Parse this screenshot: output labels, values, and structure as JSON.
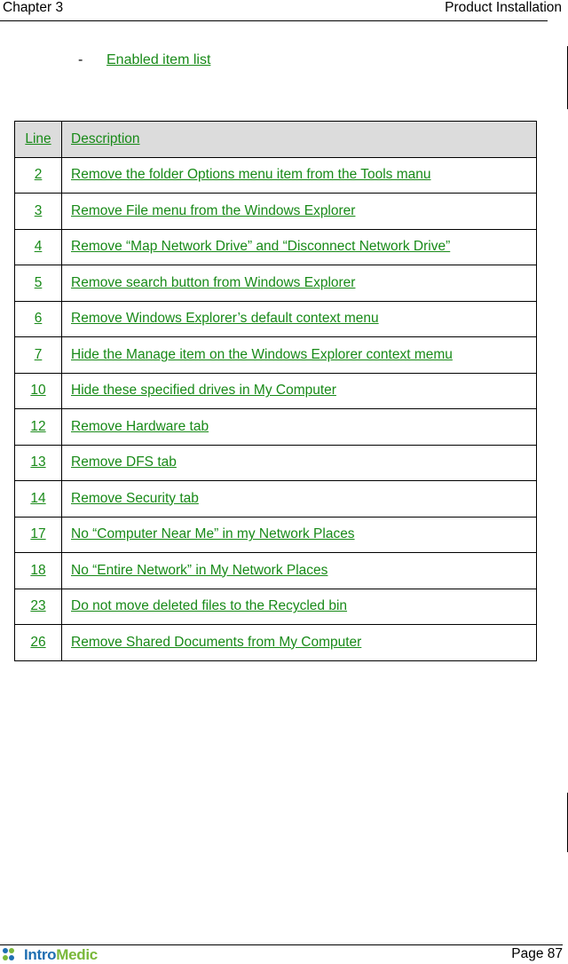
{
  "header": {
    "chapter": "Chapter 3",
    "section": "Product Installation"
  },
  "bullet": {
    "marker": "-",
    "label": "Enabled item list"
  },
  "table": {
    "columns": [
      "Line",
      "Description"
    ],
    "rows": [
      {
        "line": "2",
        "description": "Remove the folder Options menu item from the Tools manu"
      },
      {
        "line": "3",
        "description": "Remove File menu from the Windows Explorer"
      },
      {
        "line": "4",
        "description": "Remove “Map Network Drive” and “Disconnect Network Drive”"
      },
      {
        "line": "5",
        "description": "Remove search button from Windows Explorer"
      },
      {
        "line": "6",
        "description": "Remove Windows Explorer’s default context menu"
      },
      {
        "line": "7",
        "description": "Hide the Manage item on the Windows Explorer context memu"
      },
      {
        "line": "10",
        "description": "Hide these specified drives in My Computer"
      },
      {
        "line": "12",
        "description": "Remove Hardware tab"
      },
      {
        "line": "13",
        "description": "Remove DFS tab"
      },
      {
        "line": "14",
        "description": "Remove Security tab"
      },
      {
        "line": "17",
        "description": "No “Computer Near Me” in my Network Places"
      },
      {
        "line": "18",
        "description": "No “Entire Network” in My Network Places"
      },
      {
        "line": "23",
        "description": "Do not move deleted files to the Recycled bin"
      },
      {
        "line": "26",
        "description": "Remove Shared Documents from My Computer"
      }
    ]
  },
  "footer": {
    "logo_part1": "Intro",
    "logo_part2": "Medic",
    "page": "Page 87"
  },
  "colors": {
    "link_green": "#188a18",
    "header_gray": "#dcdcdc",
    "logo_blue": "#1f6fb2",
    "logo_green": "#7ab83a"
  }
}
